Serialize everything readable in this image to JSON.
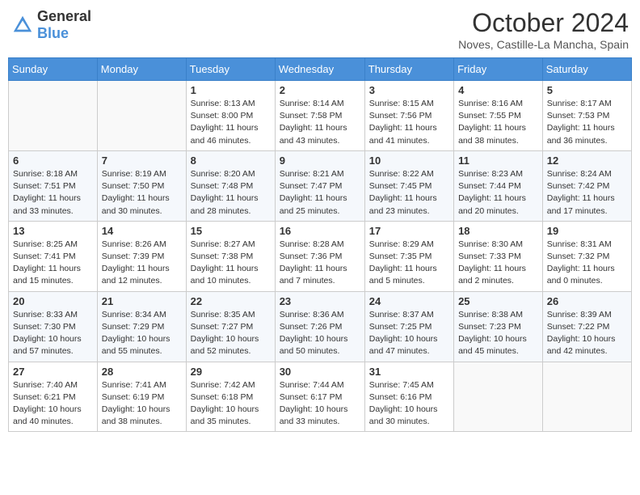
{
  "header": {
    "logo_general": "General",
    "logo_blue": "Blue",
    "month": "October 2024",
    "location": "Noves, Castille-La Mancha, Spain"
  },
  "weekdays": [
    "Sunday",
    "Monday",
    "Tuesday",
    "Wednesday",
    "Thursday",
    "Friday",
    "Saturday"
  ],
  "weeks": [
    [
      {
        "day": "",
        "sunrise": "",
        "sunset": "",
        "daylight": ""
      },
      {
        "day": "",
        "sunrise": "",
        "sunset": "",
        "daylight": ""
      },
      {
        "day": "1",
        "sunrise": "Sunrise: 8:13 AM",
        "sunset": "Sunset: 8:00 PM",
        "daylight": "Daylight: 11 hours and 46 minutes."
      },
      {
        "day": "2",
        "sunrise": "Sunrise: 8:14 AM",
        "sunset": "Sunset: 7:58 PM",
        "daylight": "Daylight: 11 hours and 43 minutes."
      },
      {
        "day": "3",
        "sunrise": "Sunrise: 8:15 AM",
        "sunset": "Sunset: 7:56 PM",
        "daylight": "Daylight: 11 hours and 41 minutes."
      },
      {
        "day": "4",
        "sunrise": "Sunrise: 8:16 AM",
        "sunset": "Sunset: 7:55 PM",
        "daylight": "Daylight: 11 hours and 38 minutes."
      },
      {
        "day": "5",
        "sunrise": "Sunrise: 8:17 AM",
        "sunset": "Sunset: 7:53 PM",
        "daylight": "Daylight: 11 hours and 36 minutes."
      }
    ],
    [
      {
        "day": "6",
        "sunrise": "Sunrise: 8:18 AM",
        "sunset": "Sunset: 7:51 PM",
        "daylight": "Daylight: 11 hours and 33 minutes."
      },
      {
        "day": "7",
        "sunrise": "Sunrise: 8:19 AM",
        "sunset": "Sunset: 7:50 PM",
        "daylight": "Daylight: 11 hours and 30 minutes."
      },
      {
        "day": "8",
        "sunrise": "Sunrise: 8:20 AM",
        "sunset": "Sunset: 7:48 PM",
        "daylight": "Daylight: 11 hours and 28 minutes."
      },
      {
        "day": "9",
        "sunrise": "Sunrise: 8:21 AM",
        "sunset": "Sunset: 7:47 PM",
        "daylight": "Daylight: 11 hours and 25 minutes."
      },
      {
        "day": "10",
        "sunrise": "Sunrise: 8:22 AM",
        "sunset": "Sunset: 7:45 PM",
        "daylight": "Daylight: 11 hours and 23 minutes."
      },
      {
        "day": "11",
        "sunrise": "Sunrise: 8:23 AM",
        "sunset": "Sunset: 7:44 PM",
        "daylight": "Daylight: 11 hours and 20 minutes."
      },
      {
        "day": "12",
        "sunrise": "Sunrise: 8:24 AM",
        "sunset": "Sunset: 7:42 PM",
        "daylight": "Daylight: 11 hours and 17 minutes."
      }
    ],
    [
      {
        "day": "13",
        "sunrise": "Sunrise: 8:25 AM",
        "sunset": "Sunset: 7:41 PM",
        "daylight": "Daylight: 11 hours and 15 minutes."
      },
      {
        "day": "14",
        "sunrise": "Sunrise: 8:26 AM",
        "sunset": "Sunset: 7:39 PM",
        "daylight": "Daylight: 11 hours and 12 minutes."
      },
      {
        "day": "15",
        "sunrise": "Sunrise: 8:27 AM",
        "sunset": "Sunset: 7:38 PM",
        "daylight": "Daylight: 11 hours and 10 minutes."
      },
      {
        "day": "16",
        "sunrise": "Sunrise: 8:28 AM",
        "sunset": "Sunset: 7:36 PM",
        "daylight": "Daylight: 11 hours and 7 minutes."
      },
      {
        "day": "17",
        "sunrise": "Sunrise: 8:29 AM",
        "sunset": "Sunset: 7:35 PM",
        "daylight": "Daylight: 11 hours and 5 minutes."
      },
      {
        "day": "18",
        "sunrise": "Sunrise: 8:30 AM",
        "sunset": "Sunset: 7:33 PM",
        "daylight": "Daylight: 11 hours and 2 minutes."
      },
      {
        "day": "19",
        "sunrise": "Sunrise: 8:31 AM",
        "sunset": "Sunset: 7:32 PM",
        "daylight": "Daylight: 11 hours and 0 minutes."
      }
    ],
    [
      {
        "day": "20",
        "sunrise": "Sunrise: 8:33 AM",
        "sunset": "Sunset: 7:30 PM",
        "daylight": "Daylight: 10 hours and 57 minutes."
      },
      {
        "day": "21",
        "sunrise": "Sunrise: 8:34 AM",
        "sunset": "Sunset: 7:29 PM",
        "daylight": "Daylight: 10 hours and 55 minutes."
      },
      {
        "day": "22",
        "sunrise": "Sunrise: 8:35 AM",
        "sunset": "Sunset: 7:27 PM",
        "daylight": "Daylight: 10 hours and 52 minutes."
      },
      {
        "day": "23",
        "sunrise": "Sunrise: 8:36 AM",
        "sunset": "Sunset: 7:26 PM",
        "daylight": "Daylight: 10 hours and 50 minutes."
      },
      {
        "day": "24",
        "sunrise": "Sunrise: 8:37 AM",
        "sunset": "Sunset: 7:25 PM",
        "daylight": "Daylight: 10 hours and 47 minutes."
      },
      {
        "day": "25",
        "sunrise": "Sunrise: 8:38 AM",
        "sunset": "Sunset: 7:23 PM",
        "daylight": "Daylight: 10 hours and 45 minutes."
      },
      {
        "day": "26",
        "sunrise": "Sunrise: 8:39 AM",
        "sunset": "Sunset: 7:22 PM",
        "daylight": "Daylight: 10 hours and 42 minutes."
      }
    ],
    [
      {
        "day": "27",
        "sunrise": "Sunrise: 7:40 AM",
        "sunset": "Sunset: 6:21 PM",
        "daylight": "Daylight: 10 hours and 40 minutes."
      },
      {
        "day": "28",
        "sunrise": "Sunrise: 7:41 AM",
        "sunset": "Sunset: 6:19 PM",
        "daylight": "Daylight: 10 hours and 38 minutes."
      },
      {
        "day": "29",
        "sunrise": "Sunrise: 7:42 AM",
        "sunset": "Sunset: 6:18 PM",
        "daylight": "Daylight: 10 hours and 35 minutes."
      },
      {
        "day": "30",
        "sunrise": "Sunrise: 7:44 AM",
        "sunset": "Sunset: 6:17 PM",
        "daylight": "Daylight: 10 hours and 33 minutes."
      },
      {
        "day": "31",
        "sunrise": "Sunrise: 7:45 AM",
        "sunset": "Sunset: 6:16 PM",
        "daylight": "Daylight: 10 hours and 30 minutes."
      },
      {
        "day": "",
        "sunrise": "",
        "sunset": "",
        "daylight": ""
      },
      {
        "day": "",
        "sunrise": "",
        "sunset": "",
        "daylight": ""
      }
    ]
  ]
}
